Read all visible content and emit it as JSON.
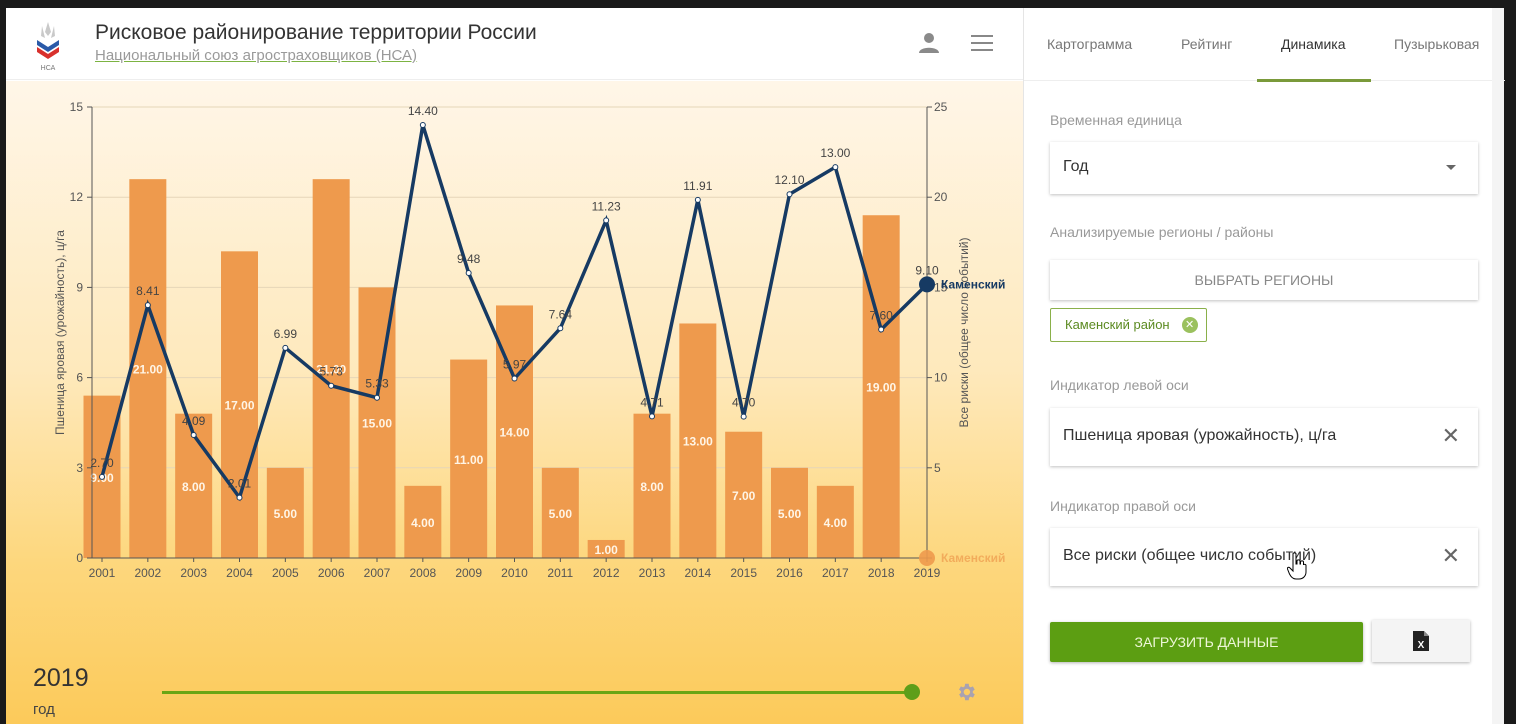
{
  "header": {
    "title": "Рисковое районирование территории России",
    "subtitle": "Национальный союз агростраховщиков (НСА)",
    "logo_text": "НСА"
  },
  "tabs": [
    {
      "label": "Картограмма",
      "active": false
    },
    {
      "label": "Рейтинг",
      "active": false
    },
    {
      "label": "Динамика",
      "active": true
    },
    {
      "label": "Пузырьковая",
      "active": false
    }
  ],
  "panel": {
    "time_unit_label": "Временная единица",
    "time_unit_value": "Год",
    "regions_label": "Анализируемые регионы / районы",
    "select_regions_button": "ВЫБРАТЬ РЕГИОНЫ",
    "region_chip": "Каменский район",
    "left_axis_label": "Индикатор левой оси",
    "left_axis_value": "Пшеница яровая (урожайность), ц/га",
    "right_axis_label": "Индикатор правой оси",
    "right_axis_value": "Все риски (общее число событий)",
    "load_button": "ЗАГРУЗИТЬ ДАННЫЕ",
    "excel_icon_letter": "X"
  },
  "timeline": {
    "year": "2019",
    "unit": "год",
    "progress": 1.0
  },
  "colors": {
    "accent_green": "#5c9e12",
    "bar": "#ee9a4d",
    "line": "#163a63"
  },
  "chart_data": {
    "type": "bar+line",
    "categories": [
      "2001",
      "2002",
      "2003",
      "2004",
      "2005",
      "2006",
      "2007",
      "2008",
      "2009",
      "2010",
      "2011",
      "2012",
      "2013",
      "2014",
      "2015",
      "2016",
      "2017",
      "2018",
      "2019"
    ],
    "series": [
      {
        "name": "Каменский",
        "kind": "line",
        "axis": "left",
        "values": [
          2.7,
          8.41,
          4.09,
          2.01,
          6.99,
          5.73,
          5.33,
          14.4,
          9.48,
          5.97,
          7.64,
          11.23,
          4.71,
          11.91,
          4.7,
          12.1,
          13.0,
          7.6,
          9.1
        ],
        "labels": [
          "2.70",
          "8.41",
          "4.09",
          "2.01",
          "6.99",
          "5.73",
          "5.33",
          "14.40",
          "9.48",
          "5.97",
          "7.64",
          "11.23",
          "4.71",
          "11.91",
          "4.70",
          "12.10",
          "13.00",
          "7.60",
          "9.10"
        ]
      },
      {
        "name": "Каменский",
        "kind": "bar",
        "axis": "right",
        "values": [
          9,
          21,
          8,
          17,
          5,
          21,
          15,
          4,
          11,
          14,
          5,
          1,
          8,
          13,
          7,
          5,
          4,
          19,
          null
        ],
        "labels": [
          "9.00",
          "21.00",
          "8.00",
          "17.00",
          "5.00",
          "21.00",
          "15.00",
          "4.00",
          "11.00",
          "14.00",
          "5.00",
          "1.00",
          "8.00",
          "13.00",
          "7.00",
          "5.00",
          "4.00",
          "19.00",
          ""
        ]
      }
    ],
    "ylabel_left": "Пшеница яровая (урожайность), ц/га",
    "ylabel_right": "Все риски (общее число событий)",
    "ylim_left": [
      0,
      15
    ],
    "ylim_right": [
      0,
      25
    ],
    "yticks_left": [
      "0",
      "3",
      "6",
      "9",
      "12",
      "15"
    ],
    "yticks_right": [
      "0",
      "5",
      "10",
      "15",
      "20",
      "25"
    ],
    "grid": true,
    "legend": [
      "Каменский",
      "Каменский"
    ],
    "legend_position": "right"
  }
}
